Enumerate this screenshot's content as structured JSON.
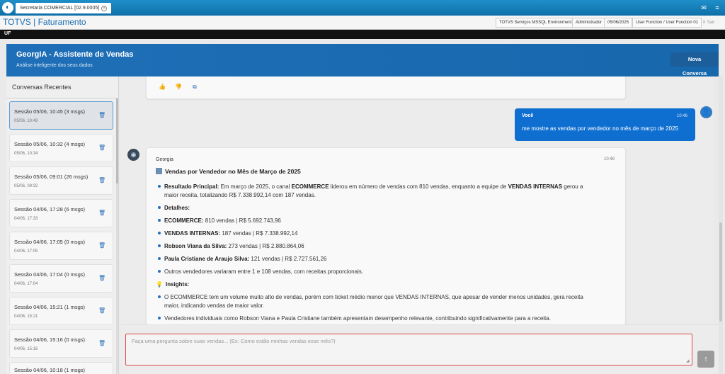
{
  "window": {
    "tab_label": "Secretaria COMERCIAL [02.9.0005]",
    "app_title": "TOTVS | Faturamento",
    "info": {
      "environment": "TOTVS Serviços MSSQL Environment",
      "user": "Administrador",
      "date": "05/06/2025",
      "function": "User Function / User Function 01",
      "close_label": "Sair"
    },
    "toolbar_label": "UF"
  },
  "header": {
    "title": "GeorgIA - Assistente de Vendas",
    "subtitle": "Análise inteligente dos seus dados",
    "new_conversation": "Nova Conversa"
  },
  "sidebar": {
    "title": "Conversas Recentes",
    "sessions": [
      {
        "title": "Sessão 05/06, 10:45 (3 msgs)",
        "date": "05/06, 10:49"
      },
      {
        "title": "Sessão 05/06, 10:32 (4 msgs)",
        "date": "05/06, 10:34"
      },
      {
        "title": "Sessão 05/06, 09:01 (26 msgs)",
        "date": "05/06, 09:32"
      },
      {
        "title": "Sessão 04/06, 17:28 (6 msgs)",
        "date": "04/06, 17:33"
      },
      {
        "title": "Sessão 04/06, 17:05 (0 msgs)",
        "date": "04/06, 17:05"
      },
      {
        "title": "Sessão 04/06, 17:04 (0 msgs)",
        "date": "04/06, 17:04"
      },
      {
        "title": "Sessão 04/06, 15:21 (1 msgs)",
        "date": "04/06, 15:21"
      },
      {
        "title": "Sessão 04/06, 15:16 (0 msgs)",
        "date": "04/06, 15:16"
      },
      {
        "title": "Sessão 04/06, 10:18 (1 msgs)",
        "date": ""
      }
    ]
  },
  "chat": {
    "user_message": {
      "name": "Você",
      "time": "10:46",
      "text": "me mostre as vendas por vendedor no mês de março de 2025"
    },
    "bot_message": {
      "name": "Georgia",
      "time": "10:49",
      "heading": "Vendas por Vendedor no Mês de Março de 2025",
      "result_label": "Resultado Principal:",
      "result_text_1": " Em março de 2025, o canal ",
      "result_bold_1": "ECOMMERCE",
      "result_text_2": " liderou em número de vendas com 810 vendas, enquanto a equipe de ",
      "result_bold_2": "VENDAS INTERNAS",
      "result_text_3": " gerou a",
      "result_text_4": "maior receita, totalizando R$ 7.338.992,14 com 187 vendas.",
      "details_label": "Detalhes:",
      "details": [
        {
          "name": "ECOMMERCE:",
          "value": " 810 vendas | R$ 5.692.743,96"
        },
        {
          "name": "VENDAS INTERNAS:",
          "value": " 187 vendas | R$ 7.338.992,14"
        },
        {
          "name": "Robson Viana da Silva:",
          "value": " 273 vendas | R$ 2.880.864,06"
        },
        {
          "name": "Paula Cristiane de Araujo Silva:",
          "value": " 121 vendas | R$ 2.727.561,26"
        }
      ],
      "others": "Outros vendedores variaram entre 1 e 108 vendas, com receitas proporcionais.",
      "insights_label": "Insights:",
      "insight_1a": "O ECOMMERCE tem um volume muito alto de vendas, porém com ticket médio menor que VENDAS INTERNAS, que apesar de vender menos unidades, gera receita",
      "insight_1b": "maior, indicando vendas de maior valor.",
      "insight_2": "Vendedores individuais como Robson Viana e Paula Cristiane também apresentam desempenho relevante, contribuindo significativamente para a receita."
    }
  },
  "input": {
    "placeholder": "Faça uma pergunta sobre suas vendas... (Ex: Como estão minhas vendas esse mês?)"
  },
  "colors": {
    "accent": "#1f6fb8",
    "user_bubble": "#0f6fd0",
    "input_border": "#e04848"
  }
}
